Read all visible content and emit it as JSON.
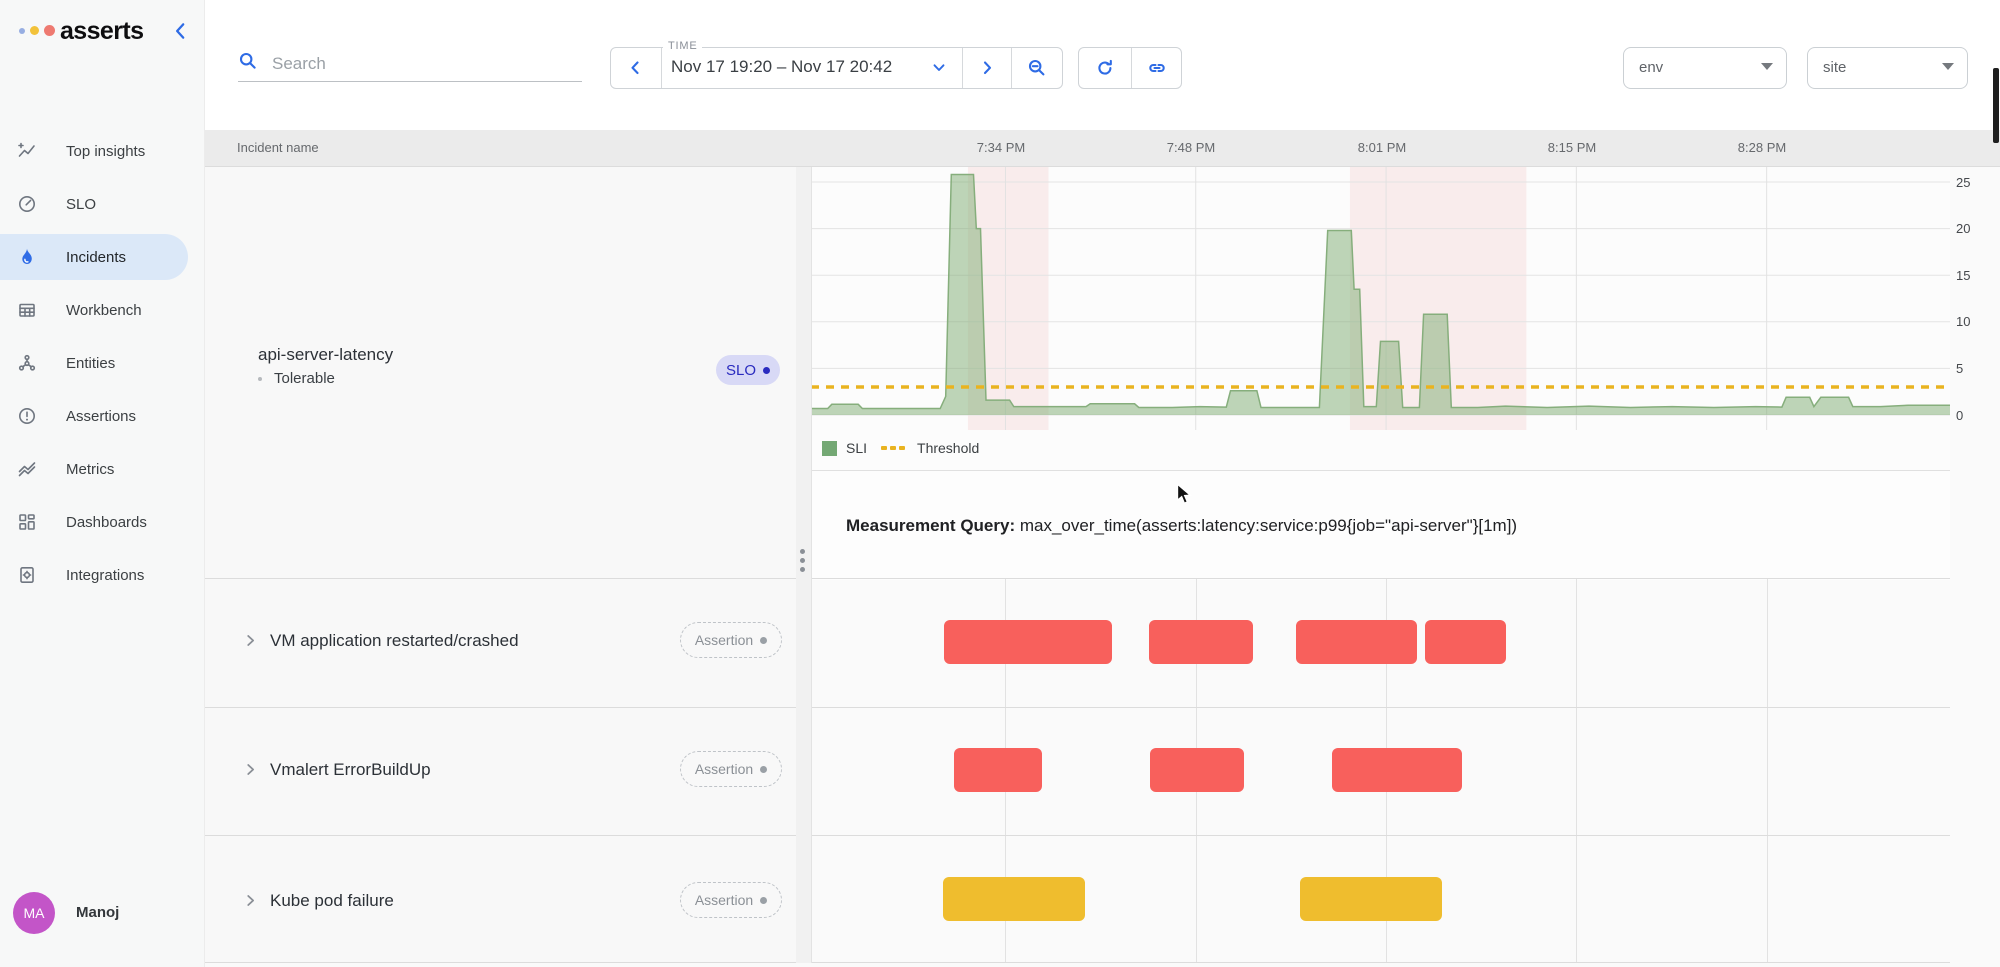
{
  "app": {
    "logo_text": "asserts"
  },
  "sidebar": {
    "items": [
      {
        "label": "Top insights"
      },
      {
        "label": "SLO"
      },
      {
        "label": "Incidents"
      },
      {
        "label": "Workbench"
      },
      {
        "label": "Entities"
      },
      {
        "label": "Assertions"
      },
      {
        "label": "Metrics"
      },
      {
        "label": "Dashboards"
      },
      {
        "label": "Integrations"
      }
    ],
    "active_item": "Incidents",
    "user": {
      "initials": "MA",
      "name": "Manoj"
    }
  },
  "topbar": {
    "search_placeholder": "Search",
    "time_label": "TIME",
    "time_range": "Nov 17 19:20 – Nov 17 20:42",
    "env_placeholder": "env",
    "site_placeholder": "site"
  },
  "grid": {
    "name_header": "Incident name",
    "time_ticks": [
      "7:34 PM",
      "7:48 PM",
      "8:01 PM",
      "8:15 PM",
      "8:28 PM"
    ]
  },
  "incidents": [
    {
      "name": "api-server-latency",
      "severity": "Tolerable",
      "badge": "SLO",
      "kind": "slo"
    },
    {
      "name": "VM application restarted/crashed",
      "badge": "Assertion",
      "kind": "assertion"
    },
    {
      "name": "Vmalert ErrorBuildUp",
      "badge": "Assertion",
      "kind": "assertion"
    },
    {
      "name": "Kube pod failure",
      "badge": "Assertion",
      "kind": "assertion"
    }
  ],
  "slo_panel": {
    "legend": {
      "sli": "SLI",
      "threshold": "Threshold"
    },
    "query_label": "Measurement Query:",
    "query_text": " max_over_time(asserts:latency:service:p99{job=\"api-server\"}[1m])"
  },
  "colors": {
    "accent_blue": "#2e6be5",
    "sli_green_stroke": "#86ae7c",
    "sli_green_fill": "rgba(125,171,114,0.5)",
    "threshold_orange": "#e9b320",
    "critical_red": "#f8605c",
    "warning_yellow": "#efbd2e",
    "incident_band": "rgba(228,100,100,0.10)",
    "slo_badge_bg": "#d8d9f6",
    "slo_badge_fg": "#2a2bbf",
    "avatar_purple": "#c355c8"
  },
  "chart_data": {
    "type": "area",
    "title": "api-server-latency SLI vs Threshold",
    "x_axis": {
      "start_time": "19:20",
      "end_time": "20:42",
      "duration_min": 82,
      "tick_labels": [
        "7:34 PM",
        "7:48 PM",
        "8:01 PM",
        "8:15 PM",
        "8:28 PM"
      ],
      "tick_minutes": [
        14,
        27.7,
        41.4,
        55.1,
        68.8
      ]
    },
    "y_axis": {
      "ticks": [
        0,
        5,
        10,
        15,
        20,
        25
      ],
      "max": 27,
      "grid": true
    },
    "series": [
      {
        "name": "SLI",
        "type": "area",
        "points_min_value": [
          [
            0,
            0.7
          ],
          [
            1.2,
            0.7
          ],
          [
            1.5,
            1.15
          ],
          [
            3.4,
            1.15
          ],
          [
            3.7,
            0.7
          ],
          [
            9.3,
            0.7
          ],
          [
            9.7,
            2
          ],
          [
            10.1,
            25.8
          ],
          [
            11.7,
            25.8
          ],
          [
            11.9,
            20
          ],
          [
            12.2,
            20
          ],
          [
            12.6,
            1.6
          ],
          [
            14.3,
            1.6
          ],
          [
            14.6,
            0.9
          ],
          [
            19.8,
            0.9
          ],
          [
            20.1,
            1.2
          ],
          [
            23.3,
            1.2
          ],
          [
            23.6,
            0.8
          ],
          [
            26,
            0.8
          ],
          [
            28,
            0.9
          ],
          [
            29.9,
            0.85
          ],
          [
            30.2,
            2.6
          ],
          [
            32.1,
            2.6
          ],
          [
            32.4,
            0.8
          ],
          [
            36.6,
            0.8
          ],
          [
            37.2,
            19.8
          ],
          [
            38.9,
            19.8
          ],
          [
            39.1,
            13.5
          ],
          [
            39.5,
            13.5
          ],
          [
            39.8,
            0.9
          ],
          [
            40.7,
            0.9
          ],
          [
            41,
            7.9
          ],
          [
            42.3,
            7.9
          ],
          [
            42.6,
            0.8
          ],
          [
            43.8,
            0.8
          ],
          [
            44.1,
            10.8
          ],
          [
            45.8,
            10.8
          ],
          [
            46.1,
            0.8
          ],
          [
            48,
            0.8
          ],
          [
            50,
            0.95
          ],
          [
            53,
            0.8
          ],
          [
            56,
            0.95
          ],
          [
            59,
            0.8
          ],
          [
            62,
            0.9
          ],
          [
            65,
            0.8
          ],
          [
            68,
            0.9
          ],
          [
            69.9,
            0.85
          ],
          [
            70.2,
            1.9
          ],
          [
            71.9,
            1.9
          ],
          [
            72.2,
            0.9
          ],
          [
            72.7,
            1.9
          ],
          [
            74.7,
            1.9
          ],
          [
            75,
            0.9
          ],
          [
            77,
            0.9
          ],
          [
            79,
            1.05
          ],
          [
            82,
            1.05
          ]
        ]
      }
    ],
    "threshold": {
      "label": "Threshold",
      "value": 3,
      "style": "dashed"
    },
    "incident_windows_min": [
      [
        11.3,
        17.1
      ],
      [
        38.8,
        51.5
      ]
    ],
    "assertion_tracks": [
      {
        "name": "VM application restarted/crashed",
        "severity": "critical",
        "ranges_min": [
          [
            9.6,
            21.7
          ],
          [
            24.3,
            31.8
          ],
          [
            34.9,
            43.6
          ],
          [
            44.2,
            50.0
          ]
        ]
      },
      {
        "name": "Vmalert ErrorBuildUp",
        "severity": "critical",
        "ranges_min": [
          [
            10.3,
            16.6
          ],
          [
            24.4,
            31.2
          ],
          [
            37.5,
            46.9
          ]
        ]
      },
      {
        "name": "Kube pod failure",
        "severity": "warning",
        "ranges_min": [
          [
            9.5,
            19.7
          ],
          [
            35.2,
            45.4
          ]
        ]
      }
    ]
  }
}
